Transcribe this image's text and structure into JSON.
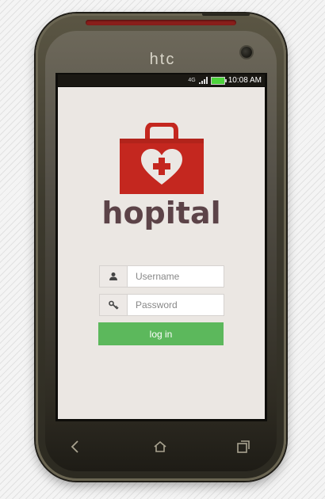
{
  "device": {
    "brand": "htc",
    "status_bar": {
      "network": "4G",
      "time": "10:08 AM",
      "battery_color": "#4dd33c"
    }
  },
  "app": {
    "name": "hopital",
    "logo_color": "#c4271f",
    "text_color": "#5c4348"
  },
  "login": {
    "username_placeholder": "Username",
    "password_placeholder": "Password",
    "username_icon": "user-icon",
    "password_icon": "key-icon",
    "button_label": "log in",
    "button_color": "#5cb85c"
  },
  "nav": {
    "back_icon": "back-icon",
    "home_icon": "home-icon",
    "recents_icon": "recents-icon"
  }
}
